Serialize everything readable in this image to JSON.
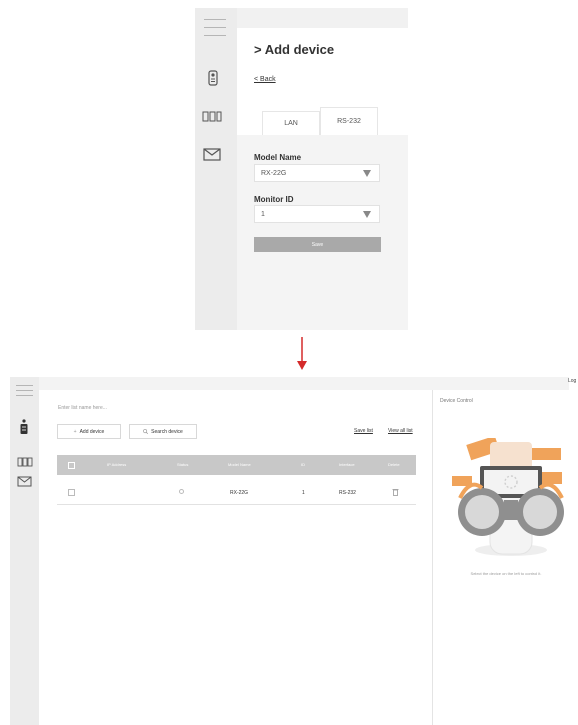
{
  "add_device_panel": {
    "title": "> Add device",
    "back_link": "< Back",
    "tabs": [
      {
        "label": "LAN",
        "selected": false
      },
      {
        "label": "RS-232",
        "selected": true
      }
    ],
    "model_name": {
      "label": "Model Name",
      "value": "RX-22G"
    },
    "monitor_id": {
      "label": "Monitor ID",
      "value": "1"
    },
    "save_label": "Save"
  },
  "device_list_panel": {
    "logout": "Log",
    "list_name_placeholder": "Enter list name here...",
    "add_device_label": "Add device",
    "search_device_label": "Search device",
    "save_list_label": "Save list",
    "view_all_list_label": "View all list",
    "table": {
      "headers": [
        "IP Address",
        "Status",
        "Model Name",
        "ID",
        "Interface",
        "Delete"
      ],
      "rows": [
        {
          "ip": "",
          "model": "RX-22G",
          "id": "1",
          "interface": "RS-232"
        }
      ]
    },
    "device_control": {
      "title": "Device Control",
      "message": "Select the device on the left to control it."
    }
  },
  "colors": {
    "sidebar_bg": "#ececec",
    "header_gray": "#c8c8c8",
    "save_button": "#a9a9a9",
    "arrow_red": "#d42a2a",
    "illustration_orange": "#f0a35a"
  }
}
